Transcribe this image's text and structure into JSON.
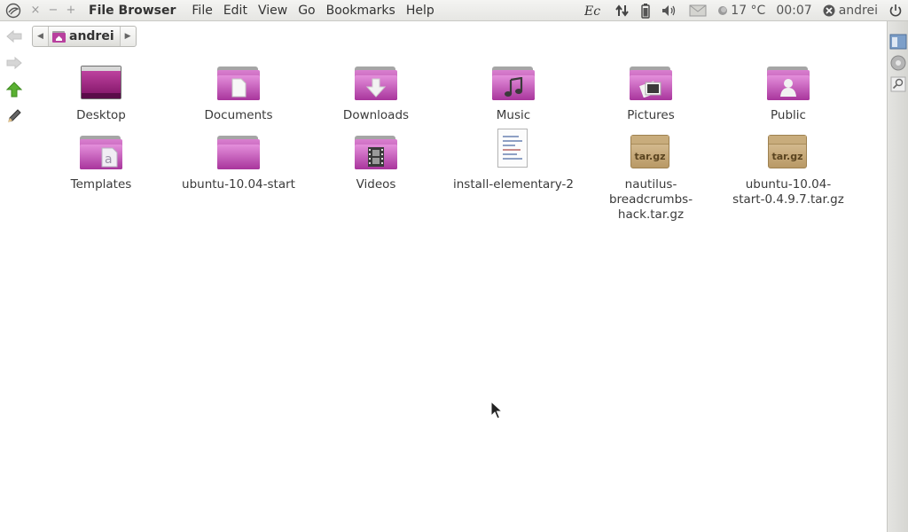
{
  "panel": {
    "app_title": "File Browser",
    "window_buttons": [
      "×",
      "−",
      "+"
    ],
    "menu": [
      "File",
      "Edit",
      "View",
      "Go",
      "Bookmarks",
      "Help"
    ],
    "tray": {
      "weather": "17 °C",
      "clock": "00:07",
      "user": "andrei"
    }
  },
  "breadcrumb": {
    "current": "andrei"
  },
  "files": [
    {
      "name": "Desktop",
      "icon": "desktop-icon"
    },
    {
      "name": "Documents",
      "icon": "documents-folder-icon"
    },
    {
      "name": "Downloads",
      "icon": "downloads-folder-icon"
    },
    {
      "name": "Music",
      "icon": "music-folder-icon"
    },
    {
      "name": "Pictures",
      "icon": "pictures-folder-icon"
    },
    {
      "name": "Public",
      "icon": "public-folder-icon"
    },
    {
      "name": "Templates",
      "icon": "templates-folder-icon"
    },
    {
      "name": "ubuntu-10.04-start",
      "icon": "folder-icon"
    },
    {
      "name": "Videos",
      "icon": "videos-folder-icon"
    },
    {
      "name": "install-elementary-2",
      "icon": "text-file-icon"
    },
    {
      "name": "nautilus-breadcrumbs-hack.tar.gz",
      "icon": "archive-icon",
      "badge": "tar.gz"
    },
    {
      "name": "ubuntu-10.04-start-0.4.9.7.tar.gz",
      "icon": "archive-icon",
      "badge": "tar.gz"
    }
  ],
  "colors": {
    "folder": "#b447a8",
    "panel_bg": "#ecece9",
    "up_arrow": "#4fa32c"
  }
}
